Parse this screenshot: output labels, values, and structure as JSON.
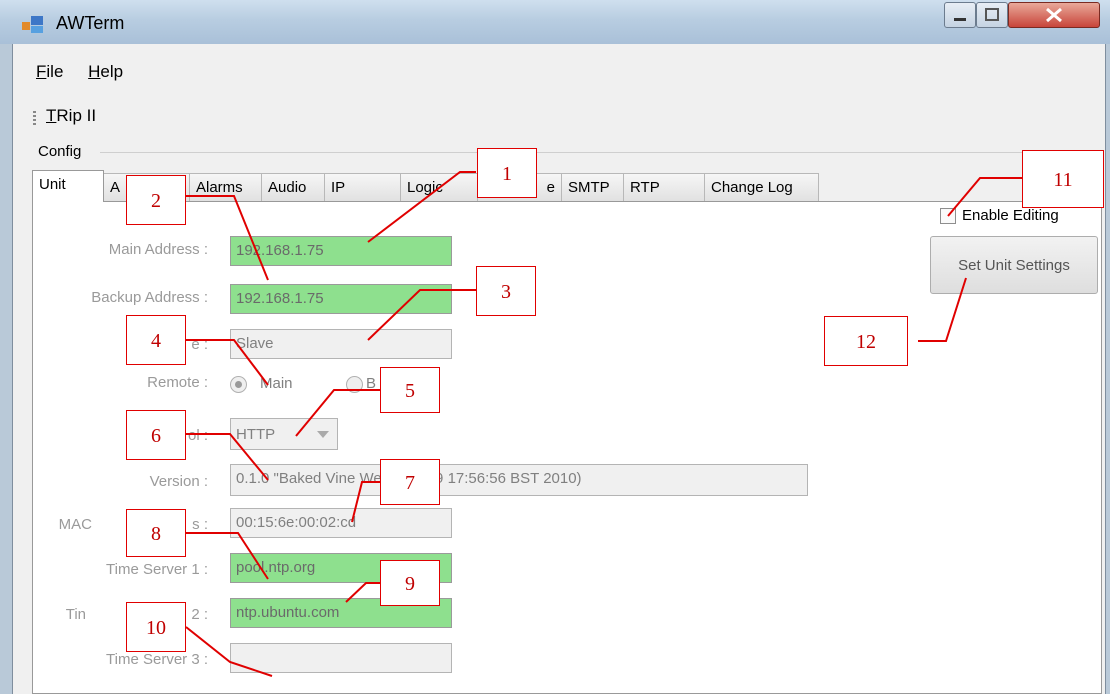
{
  "window": {
    "title": "AWTerm"
  },
  "menu": {
    "file": {
      "first": "F",
      "rest": "ile"
    },
    "help": {
      "first": "H",
      "rest": "elp"
    }
  },
  "toolstrip": {
    "item": {
      "first": "T",
      "rest": "Rip II"
    }
  },
  "config": {
    "label": "Config"
  },
  "tabs": [
    "Unit",
    "A",
    "Alarms",
    "Audio",
    "IP",
    "Logic",
    "e",
    "SMTP",
    "RTP",
    "Change Log"
  ],
  "form": {
    "main_address": {
      "label": "Main Address :",
      "value": "192.168.1.75"
    },
    "backup_address": {
      "label": "Backup Address :",
      "value": "192.168.1.75"
    },
    "mode": {
      "label": "e :",
      "value": "Slave"
    },
    "remote": {
      "label": "Remote :",
      "opt_main": "Main",
      "opt_backup": "B"
    },
    "protocol": {
      "label": "ol :",
      "value": "HTTP"
    },
    "version": {
      "label": "Version :",
      "value": "0.1.0 \"Baked Vine   Wed May 19 17:56:56 BST 2010)"
    },
    "mac": {
      "label_a": "MAC",
      "label_b": "s :",
      "value": "00:15:6e:00:02:cd"
    },
    "time1": {
      "label": "Time Server 1 :",
      "value": "pool.ntp.org"
    },
    "time2": {
      "label_a": "Tin",
      "label_b": "2 :",
      "value": "ntp.ubuntu.com"
    },
    "time3": {
      "label": "Time Server 3 :",
      "value": ""
    }
  },
  "enable_editing": {
    "label": "Enable Editing",
    "checked": false
  },
  "set_unit_button": {
    "label": "Set Unit Settings"
  },
  "callouts": [
    "1",
    "2",
    "3",
    "4",
    "5",
    "6",
    "7",
    "8",
    "9",
    "10",
    "11",
    "12"
  ],
  "colors": {
    "callout": "#e00000",
    "field_green": "#8ee08e"
  }
}
